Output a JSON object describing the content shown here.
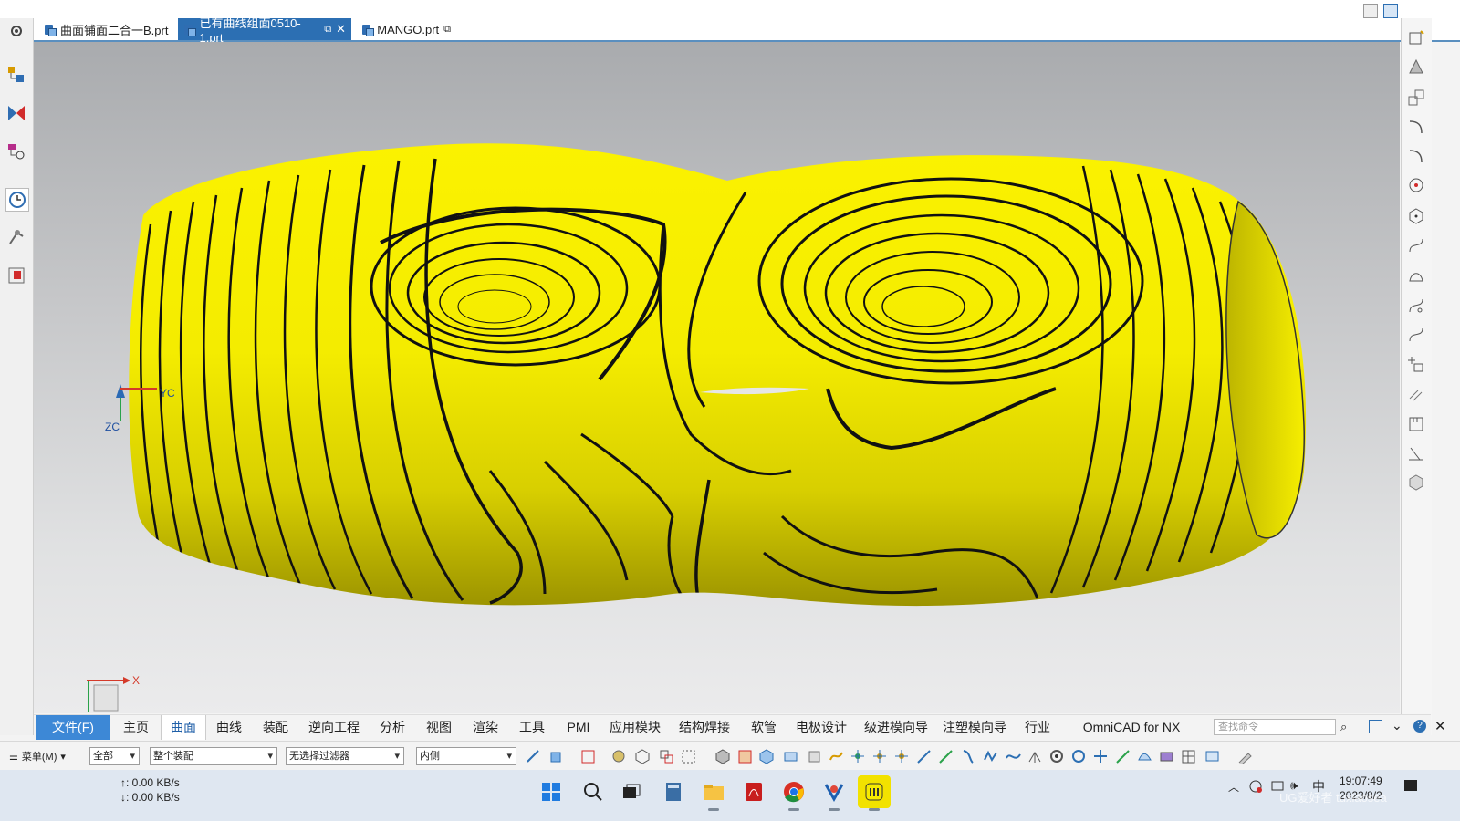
{
  "tabs": [
    {
      "label": "曲面铺面二合一B.prt",
      "active": false
    },
    {
      "label": "已有曲线组面0510-1.prt",
      "active": true
    },
    {
      "label": "MANGO.prt",
      "active": false
    }
  ],
  "viewport": {
    "triad_labels": {
      "zc": "ZC",
      "yc": "YC"
    },
    "axis_label_x": "X"
  },
  "ribbon": {
    "file_label": "文件(F)",
    "tabs": [
      "主页",
      "曲面",
      "曲线",
      "装配",
      "逆向工程",
      "分析",
      "视图",
      "渲染",
      "工具",
      "PMI",
      "应用模块",
      "结构焊接",
      "软管",
      "电极设计",
      "级进模向导",
      "注塑模向导",
      "行业",
      "OmniCAD for NX"
    ],
    "active_tab": "曲面",
    "search_placeholder": "查找命令"
  },
  "selection_bar": {
    "menu_label": "菜单(M)",
    "filter_type": "全部",
    "scope": "整个装配",
    "selection_filter": "无选择过滤器",
    "inside_mode": "内侧"
  },
  "taskbar": {
    "upload_speed": "↑: 0.00 KB/s",
    "download_speed": "↓: 0.00 KB/s",
    "ime": "中",
    "time": "19:07:49",
    "date": "2023/8/2",
    "watermark": "UG爱好者 tuxiaosea"
  },
  "colors": {
    "surface": "#f5f000",
    "contour": "#111111",
    "accent": "#3d88d6"
  }
}
